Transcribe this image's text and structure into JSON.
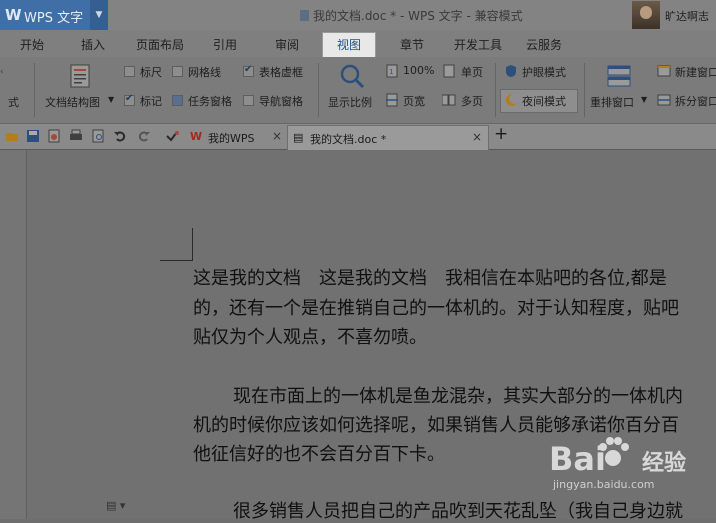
{
  "titlebar": {
    "logo": "W",
    "app_name": "WPS 文字",
    "window_title": "我的文档.doc * - WPS 文字 - 兼容模式",
    "user_name": "旷达啊志"
  },
  "menu_tabs": [
    {
      "label": "开始"
    },
    {
      "label": "插入"
    },
    {
      "label": "页面布局"
    },
    {
      "label": "引用"
    },
    {
      "label": "审阅"
    },
    {
      "label": "视图",
      "active": true
    },
    {
      "label": "章节"
    },
    {
      "label": "开发工具"
    },
    {
      "label": "云服务"
    }
  ],
  "ribbon": {
    "cut_label": "式",
    "doc_structure": "文档结构图",
    "ruler": "标尺",
    "gridlines": "网格线",
    "table_gridlines": "表格虚框",
    "bookmark": "标记",
    "task_pane": "任务窗格",
    "nav_pane": "导航窗格",
    "zoom": "显示比例",
    "zoom_100": "100%",
    "page_width": "页宽",
    "single_page": "单页",
    "multi_page": "多页",
    "eye_mode": "护眼模式",
    "night_mode": "夜间模式",
    "arrange": "重排窗口",
    "new_window": "新建窗口",
    "split_window": "拆分窗口",
    "checks": {
      "ruler": false,
      "gridlines": false,
      "table_gridlines": true,
      "bookmark": true,
      "task_pane": false,
      "nav_pane": false
    }
  },
  "doc_tabs": [
    {
      "label": "我的WPS",
      "close": "×"
    },
    {
      "label": "我的文档.doc *",
      "close": "×"
    }
  ],
  "add_tab": "+",
  "document": {
    "lines": [
      "这是我的文档　这是我的文档　我相信在本贴吧的各位,都是",
      "的，还有一个是在推销自己的一体机的。对于认知程度，贴吧",
      "贴仅为个人观点，不喜勿喷。",
      "现在市面上的一体机是鱼龙混杂，其实大部分的一体机内",
      "机的时候你应该如何选择呢，如果销售人员能够承诺你百分百",
      "他征信好的也不会百分百下卡。",
      "很多销售人员把自己的产品吹到天花乱坠（我自己身边就"
    ]
  },
  "watermark": {
    "brand": "Bai",
    "brand_cn": "经验",
    "url": "jingyan.baidu.com"
  },
  "colors": {
    "accent": "#3f6fa6",
    "active_tab_text": "#1e4f8a"
  }
}
